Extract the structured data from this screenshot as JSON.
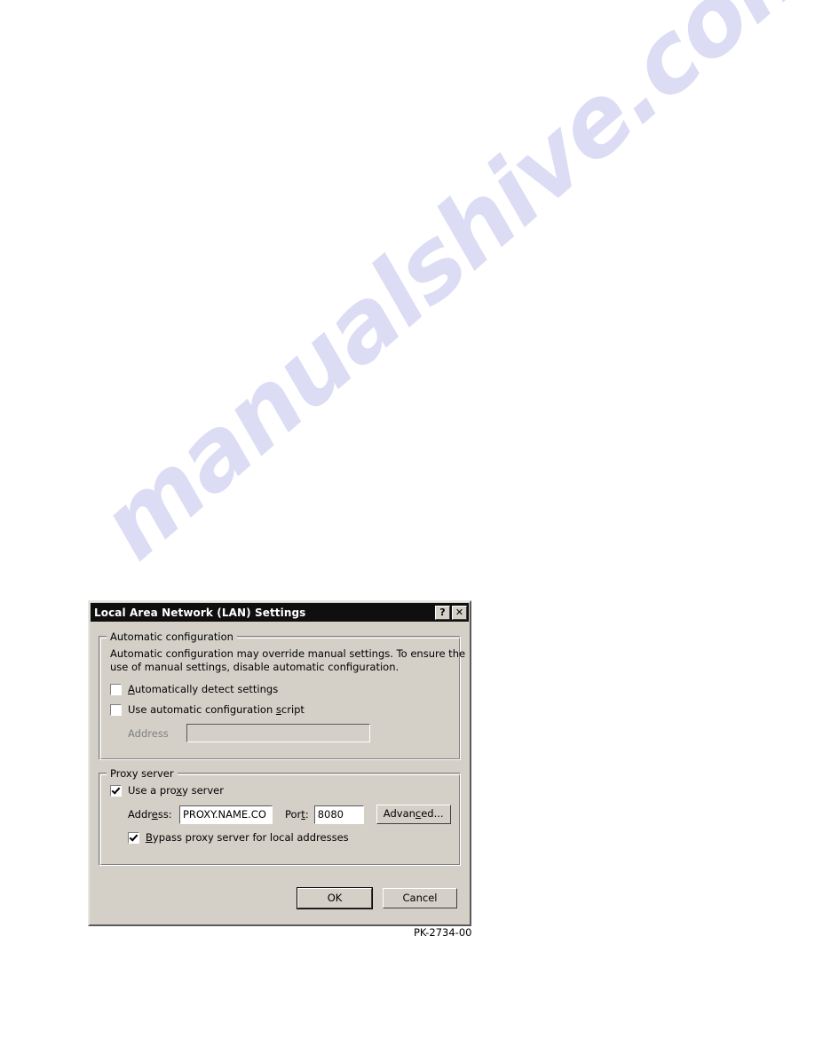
{
  "page": {
    "watermark_text": "manualshive.com",
    "watermark_color": "#a8a8e6",
    "background_color": "#ffffff",
    "figure_caption": "PK-2734-00"
  },
  "dialog": {
    "title": "Local Area Network (LAN) Settings",
    "titlebar_color": "#100f10",
    "face_color": "#d4d0c8",
    "help_button_label": "?",
    "close_button_label": "✕",
    "automatic_configuration": {
      "group_title": "Automatic configuration",
      "help_line_1": "Automatic configuration may override manual settings.  To ensure the",
      "help_line_2": "use of manual settings, disable automatic configuration.",
      "detect_settings": {
        "label_pre": "",
        "label_accel": "A",
        "label_post": "utomatically detect settings",
        "checked": false
      },
      "use_script": {
        "label_pre": "Use automatic configuration ",
        "label_accel": "s",
        "label_post": "cript",
        "checked": false
      },
      "address_label": "Address",
      "address_value": "",
      "address_disabled": true
    },
    "proxy_server": {
      "group_title": "Proxy server",
      "use_proxy": {
        "label_pre": "Use a pro",
        "label_accel": "x",
        "label_post": "y server",
        "checked": true
      },
      "address_label_pre": "Addr",
      "address_label_accel": "e",
      "address_label_post": "ss:",
      "address_value": "PROXY.NAME.CO",
      "port_label_pre": "Por",
      "port_label_accel": "t",
      "port_label_post": ":",
      "port_value": "8080",
      "advanced_label_pre": "Advan",
      "advanced_label_accel": "c",
      "advanced_label_post": "ed...",
      "bypass_local": {
        "label_pre": "",
        "label_accel": "B",
        "label_post": "ypass proxy server for local addresses",
        "checked": true
      }
    },
    "ok_label": "OK",
    "cancel_label": "Cancel"
  }
}
